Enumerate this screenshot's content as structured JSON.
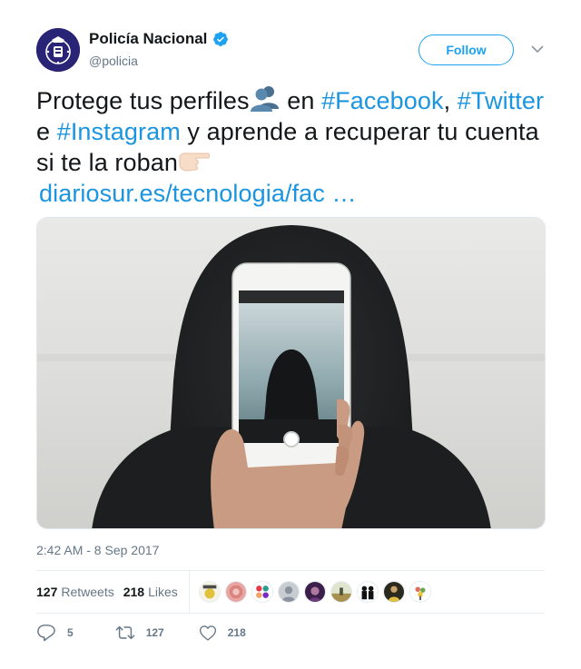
{
  "author": {
    "display_name": "Policía Nacional",
    "handle": "@policia",
    "verified": true,
    "avatar_icon": "police-badge-icon",
    "avatar_color": "#2a2477"
  },
  "follow_button": {
    "label": "Follow"
  },
  "tweet": {
    "text_part1": "Protege tus perfiles",
    "text_part2": " en ",
    "hashtag_facebook": "#Facebook",
    "comma": ",",
    "hashtag_twitter": "#Twitter",
    "text_part3": " e ",
    "hashtag_instagram": "#Instagram",
    "text_part4": " y aprende a recuperar tu cuenta si te la roban",
    "link": "diariosur.es/tecnologia/fac",
    "link_ellipsis": " …"
  },
  "media": {
    "description_icon": "hooded-person-holding-phone-photo"
  },
  "timestamp": "2:42 AM - 8 Sep 2017",
  "stats": {
    "retweets_count": "127",
    "retweets_label": "Retweets",
    "likes_count": "218",
    "likes_label": "Likes"
  },
  "actions": {
    "reply_count": "5",
    "retweet_count": "127",
    "like_count": "218"
  },
  "colors": {
    "link": "#1b95e0",
    "accent": "#1da1f2",
    "secondary_text": "#657786"
  }
}
